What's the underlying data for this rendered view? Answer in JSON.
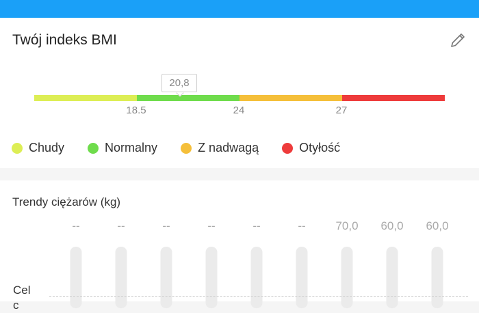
{
  "header": {
    "title": "Twój indeks BMI",
    "edit_icon": "pencil-icon"
  },
  "bmi": {
    "value": "20,8",
    "value_numeric": 20.8,
    "scale_min": 15,
    "scale_max": 33,
    "ticks": [
      "18.5",
      "24",
      "27"
    ],
    "segments": [
      {
        "name": "Chudy",
        "color": "#ddee55"
      },
      {
        "name": "Normalny",
        "color": "#6fdc4c"
      },
      {
        "name": "Z nadwagą",
        "color": "#f5bf3a"
      },
      {
        "name": "Otyłość",
        "color": "#ee3b3b"
      }
    ]
  },
  "legend": [
    {
      "label": "Chudy",
      "color": "#ddee55"
    },
    {
      "label": "Normalny",
      "color": "#6fdc4c"
    },
    {
      "label": "Z nadwagą",
      "color": "#f5bf3a"
    },
    {
      "label": "Otyłość",
      "color": "#ee3b3b"
    }
  ],
  "trend": {
    "title": "Trendy ciężarów (kg)",
    "values": [
      "--",
      "--",
      "--",
      "--",
      "--",
      "--",
      "70,0",
      "60,0",
      "60,0"
    ],
    "goal_label": "Cel",
    "goal_label_line2": "c"
  },
  "colors": {
    "topbar": "#1aa0f8"
  }
}
